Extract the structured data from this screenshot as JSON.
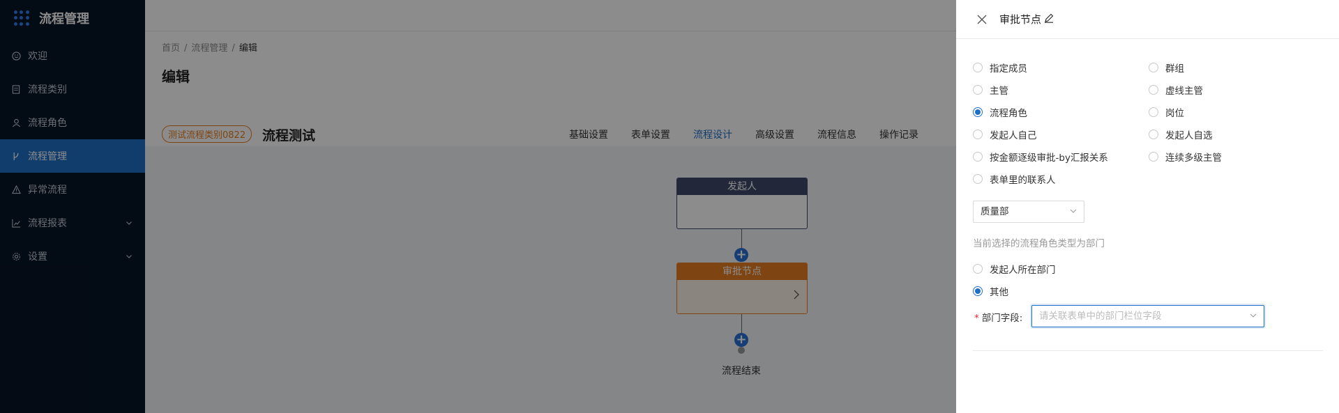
{
  "sidebar": {
    "brand": "流程管理",
    "items": [
      {
        "label": "欢迎",
        "icon": "smile-icon"
      },
      {
        "label": "流程类别",
        "icon": "book-icon"
      },
      {
        "label": "流程角色",
        "icon": "user-icon"
      },
      {
        "label": "流程管理",
        "icon": "branch-icon",
        "active": true
      },
      {
        "label": "异常流程",
        "icon": "warning-icon"
      },
      {
        "label": "流程报表",
        "icon": "chart-icon",
        "expandable": true
      },
      {
        "label": "设置",
        "icon": "gear-icon",
        "expandable": true
      }
    ]
  },
  "breadcrumb": [
    "首页",
    "流程管理",
    "编辑"
  ],
  "page_title": "编辑",
  "flow": {
    "category_tag": "测试流程类别0822",
    "name": "流程测试"
  },
  "tabs": [
    {
      "label": "基础设置"
    },
    {
      "label": "表单设置"
    },
    {
      "label": "流程设计",
      "active": true
    },
    {
      "label": "高级设置"
    },
    {
      "label": "流程信息"
    },
    {
      "label": "操作记录"
    }
  ],
  "canvas": {
    "start_node": "发起人",
    "approval_node": "审批节点",
    "end_label": "流程结束"
  },
  "drawer": {
    "title": "审批节点",
    "approver_options": [
      {
        "label": "指定成员",
        "checked": false
      },
      {
        "label": "群组",
        "checked": false
      },
      {
        "label": "主管",
        "checked": false
      },
      {
        "label": "虚线主管",
        "checked": false
      },
      {
        "label": "流程角色",
        "checked": true
      },
      {
        "label": "岗位",
        "checked": false
      },
      {
        "label": "发起人自己",
        "checked": false
      },
      {
        "label": "发起人自选",
        "checked": false
      },
      {
        "label": "按金额逐级审批-by汇报关系",
        "checked": false
      },
      {
        "label": "连续多级主管",
        "checked": false
      },
      {
        "label": "表单里的联系人",
        "checked": false
      }
    ],
    "role_select_value": "质量部",
    "hint": "当前选择的流程角色类型为部门",
    "dept_options": [
      {
        "label": "发起人所在部门",
        "checked": false
      },
      {
        "label": "其他",
        "checked": true
      }
    ],
    "dept_field_label": "部门字段:",
    "dept_field_placeholder": "请关联表单中的部门栏位字段"
  },
  "colors": {
    "sidebar_bg": "#071426",
    "accent": "#1f6fc5",
    "start_node": "#3e4a6b",
    "approval_node": "#e67e22"
  }
}
